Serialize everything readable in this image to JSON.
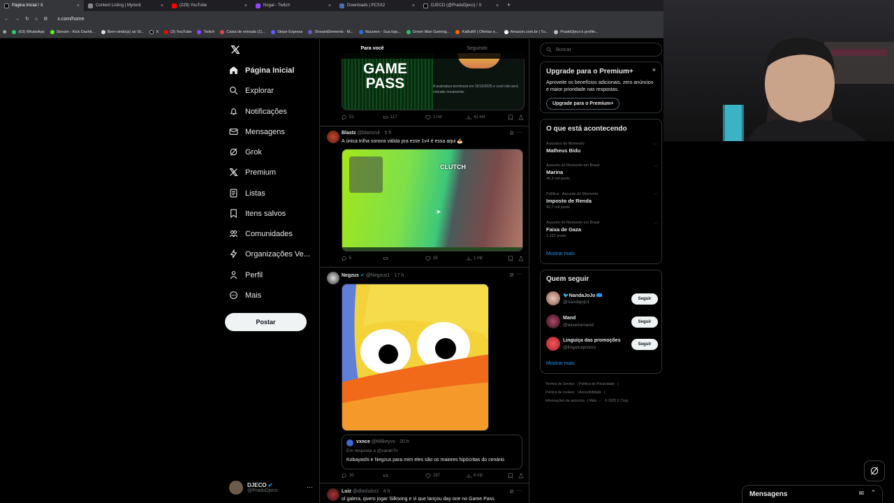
{
  "browser": {
    "tabs": [
      {
        "label": "Página Inicial / X",
        "active": true
      },
      {
        "label": "Content Listing | Myrient"
      },
      {
        "label": "(229) YouTube"
      },
      {
        "label": "Nogal - Twitch"
      },
      {
        "label": "Downloads | PCSX2"
      },
      {
        "label": "DJECO (@PradoDjeco) / X"
      }
    ],
    "url": "x.com/home",
    "bookmarks": [
      "(63) WhatsApp",
      "Stream - Kick Dashb...",
      "Bem-vindo(a) ao St...",
      "X",
      "(3) YouTube",
      "Twitch",
      "Caixa de entrada (1)...",
      "Stripe Express",
      "StreamElements - M...",
      "Nuuvem - Sua loja...",
      "Green Man Gaming...",
      "KaBuM! | Ofertas e...",
      "Amazon.com.br | Tu...",
      "PradoDjeco's profile..."
    ]
  },
  "nav": {
    "items": [
      {
        "label": "Página Inicial",
        "icon": "home-icon",
        "active": true
      },
      {
        "label": "Explorar",
        "icon": "search-icon"
      },
      {
        "label": "Notificações",
        "icon": "bell-icon"
      },
      {
        "label": "Mensagens",
        "icon": "mail-icon"
      },
      {
        "label": "Grok",
        "icon": "grok-icon"
      },
      {
        "label": "Premium",
        "icon": "x-logo-icon"
      },
      {
        "label": "Listas",
        "icon": "list-icon"
      },
      {
        "label": "Itens salvos",
        "icon": "bookmark-icon"
      },
      {
        "label": "Comunidades",
        "icon": "people-icon"
      },
      {
        "label": "Organizações Ve...",
        "icon": "lightning-icon"
      },
      {
        "label": "Perfil",
        "icon": "person-icon"
      },
      {
        "label": "Mais",
        "icon": "more-circle-icon"
      }
    ],
    "post_label": "Postar",
    "account": {
      "name": "DJECO",
      "handle": "@PradoDjeco"
    }
  },
  "timeline": {
    "tabs": [
      "Para você",
      "Seguindo"
    ],
    "post0": {
      "media_title": "GAME\nPASS",
      "media_notice": "A assinatura terminará em 15/10/2025 e você não será cobrado novamente.",
      "replies": "51",
      "reposts": "117",
      "likes": "1 mil",
      "views": "41 mil"
    },
    "post1": {
      "name": "Blastz",
      "handle": "@blastzvlr",
      "time": "5 h",
      "text": "A única trilha sonora válida pra esse 1v4 é essa aqui 🍝",
      "media_badge": "CLUTCH",
      "replies": "5",
      "likes": "25",
      "views": "1 mil"
    },
    "post2": {
      "name": "Negzus",
      "handle": "@Negzus1",
      "time": "17 h",
      "quote": {
        "name": "vxnce",
        "handle": "@Milkeyvx",
        "time": "20 h",
        "reply_to": "Em resposta a @sandr7n",
        "text": "Kobayashi e Negzus para mim eles são os maiores hipócritas do cenário"
      },
      "replies": "30",
      "likes": "167",
      "views": "8 mil"
    },
    "post3": {
      "name": "Luiz",
      "handle": "@dlaslulzzz",
      "time": "4 h",
      "text": "ol galera, quero jogar Silksong e vi que lançou day one no Game Pass"
    }
  },
  "right": {
    "search_placeholder": "Buscar",
    "premium": {
      "title": "Upgrade para o Premium+",
      "body": "Aproveite os benefícios adicionais, zero anúncios e maior prioridade nas respostas.",
      "button": "Upgrade para o Premium+"
    },
    "trends_title": "O que está acontecendo",
    "trends": [
      {
        "context": "Assuntos do Momento",
        "name": "Matheus Bidu",
        "posts": ""
      },
      {
        "context": "Assunto do Momento em Brasil",
        "name": "Marina",
        "posts": "45,2 mil posts"
      },
      {
        "context": "Política · Assunto do Momento",
        "name": "Imposto de Renda",
        "posts": "42,7 mil posts"
      },
      {
        "context": "Assunto do Momento em Brasil",
        "name": "Faixa de Gaza",
        "posts": "1.122 posts"
      }
    ],
    "show_more": "Mostrar mais",
    "who_title": "Quem seguir",
    "who": [
      {
        "name": "🐦NandaJoJo",
        "handle": "@nandajojo1",
        "button": "Seguir"
      },
      {
        "name": "Mand",
        "handle": "@teixeiramand",
        "button": "Seguir"
      },
      {
        "name": "Linguiça das promoções",
        "handle": "@linguicapromo",
        "button": "Seguir"
      }
    ],
    "who_more": "Mostrar mais",
    "footer": [
      "Termos de Serviço",
      "Política de Privacidade",
      "Política de cookies",
      "Acessibilidade",
      "Informações de anúncios",
      "Mais ···",
      "© 2025 X Corp."
    ]
  },
  "messages_drawer": "Mensagens",
  "colors": {
    "accent": "#1d9bf0",
    "bg": "#000000",
    "border": "#2f3336",
    "muted": "#71767b"
  }
}
